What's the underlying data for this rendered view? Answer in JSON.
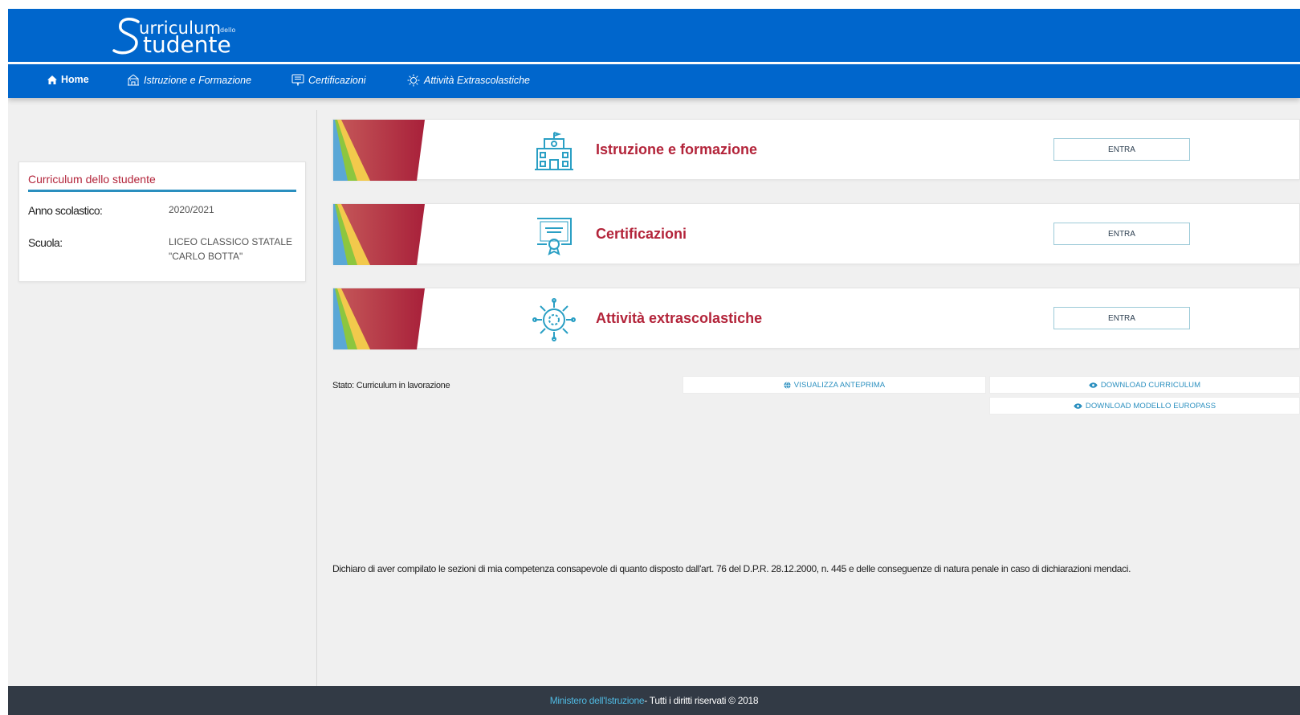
{
  "brand": {
    "line1": "urriculum",
    "line1_small": "dello",
    "line2": "tudente",
    "color": "#0066cc"
  },
  "nav": {
    "items": [
      {
        "label": "Home",
        "icon": "home-icon"
      },
      {
        "label": "Istruzione e Formazione",
        "icon": "school-icon"
      },
      {
        "label": "Certificazioni",
        "icon": "certificate-icon"
      },
      {
        "label": "Attività Extrascolastiche",
        "icon": "gear-icon"
      }
    ]
  },
  "sidebar": {
    "title": "Curriculum dello studente",
    "anno_label": "Anno scolastico:",
    "anno_value": "2020/2021",
    "scuola_label": "Scuola:",
    "scuola_value_line1": "LICEO CLASSICO STATALE",
    "scuola_value_line2": "\"CARLO BOTTA\""
  },
  "sections": [
    {
      "title": "Istruzione e formazione",
      "button": "ENTRA",
      "icon": "school-building-icon"
    },
    {
      "title": "Certificazioni",
      "button": "ENTRA",
      "icon": "certificate-icon"
    },
    {
      "title": "Attività extrascolastiche",
      "button": "ENTRA",
      "icon": "activity-gear-icon"
    }
  ],
  "status": {
    "text": "Stato: Curriculum in lavorazione"
  },
  "actions": {
    "preview": "VISUALIZZA ANTEPRIMA",
    "download_curriculum": "DOWNLOAD CURRICULUM",
    "download_europass": "DOWNLOAD MODELLO EUROPASS"
  },
  "declaration": "Dichiaro di aver compilato le sezioni di mia competenza consapevole di quanto disposto dall'art. 76 del D.P.R. 28.12.2000, n. 445 e delle conseguenze di natura penale in caso di dichiarazioni mendaci.",
  "footer": {
    "link": "Ministero dell'Istruzione",
    "text": " - Tutti i diritti riservati © 2018"
  },
  "colors": {
    "header_blue": "#0066cc",
    "title_red": "#b3243a",
    "accent_teal": "#2a8fbf",
    "footer_dark": "#323a45"
  }
}
